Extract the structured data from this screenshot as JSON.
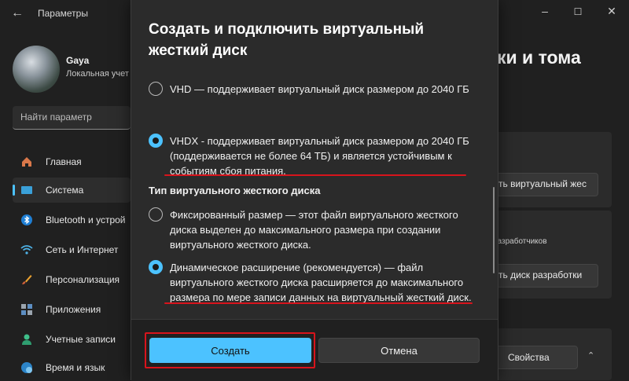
{
  "window": {
    "title": "Параметры",
    "controls": [
      "minimize",
      "maximize",
      "close"
    ]
  },
  "profile": {
    "name": "Gaya",
    "account": "Локальная учет"
  },
  "search": {
    "placeholder": "Найти параметр"
  },
  "sidebar": {
    "items": [
      {
        "label": "Главная",
        "icon": "home-icon",
        "active": false
      },
      {
        "label": "Система",
        "icon": "system-icon",
        "active": true
      },
      {
        "label": "Bluetooth и устрой",
        "icon": "bluetooth-icon",
        "active": false
      },
      {
        "label": "Сеть и Интернет",
        "icon": "wifi-icon",
        "active": false
      },
      {
        "label": "Персонализация",
        "icon": "brush-icon",
        "active": false
      },
      {
        "label": "Приложения",
        "icon": "apps-icon",
        "active": false
      },
      {
        "label": "Учетные записи",
        "icon": "account-icon",
        "active": false
      },
      {
        "label": "Время и язык",
        "icon": "globe-icon",
        "active": false
      }
    ]
  },
  "background_page": {
    "heading": "ки и тома",
    "button_create_vhd": "ть виртуальный жес",
    "dev_text": "разработчиков",
    "button_dev_disk": "ть диск разработки",
    "button_properties": "Свойства"
  },
  "dialog": {
    "title": "Создать и подключить виртуальный жесткий диск",
    "format_options": [
      {
        "text": "VHD — поддерживает виртуальный диск размером до 2040 ГБ",
        "selected": false
      },
      {
        "text": "VHDX - поддерживает виртуальный диск размером до 2040 ГБ (поддерживается не более 64 ТБ) и является устойчивым к событиям сбоя питания.",
        "selected": true
      }
    ],
    "type_label": "Тип виртуального жесткого диска",
    "type_options": [
      {
        "text": "Фиксированный размер — этот файл виртуального жесткого диска выделен до максимального размера при создании виртуального жесткого диска.",
        "selected": false
      },
      {
        "text": "Динамическое расширение (рекомендуется) — файл виртуального жесткого диска расширяется до максимального размера по мере записи данных на виртуальный жесткий диск.",
        "selected": true
      }
    ],
    "create_label": "Создать",
    "cancel_label": "Отмена"
  },
  "colors": {
    "accent": "#4cc2ff",
    "annotation_red": "#d8141c",
    "dialog_bg": "#2b2b2b",
    "window_bg": "#202020"
  }
}
